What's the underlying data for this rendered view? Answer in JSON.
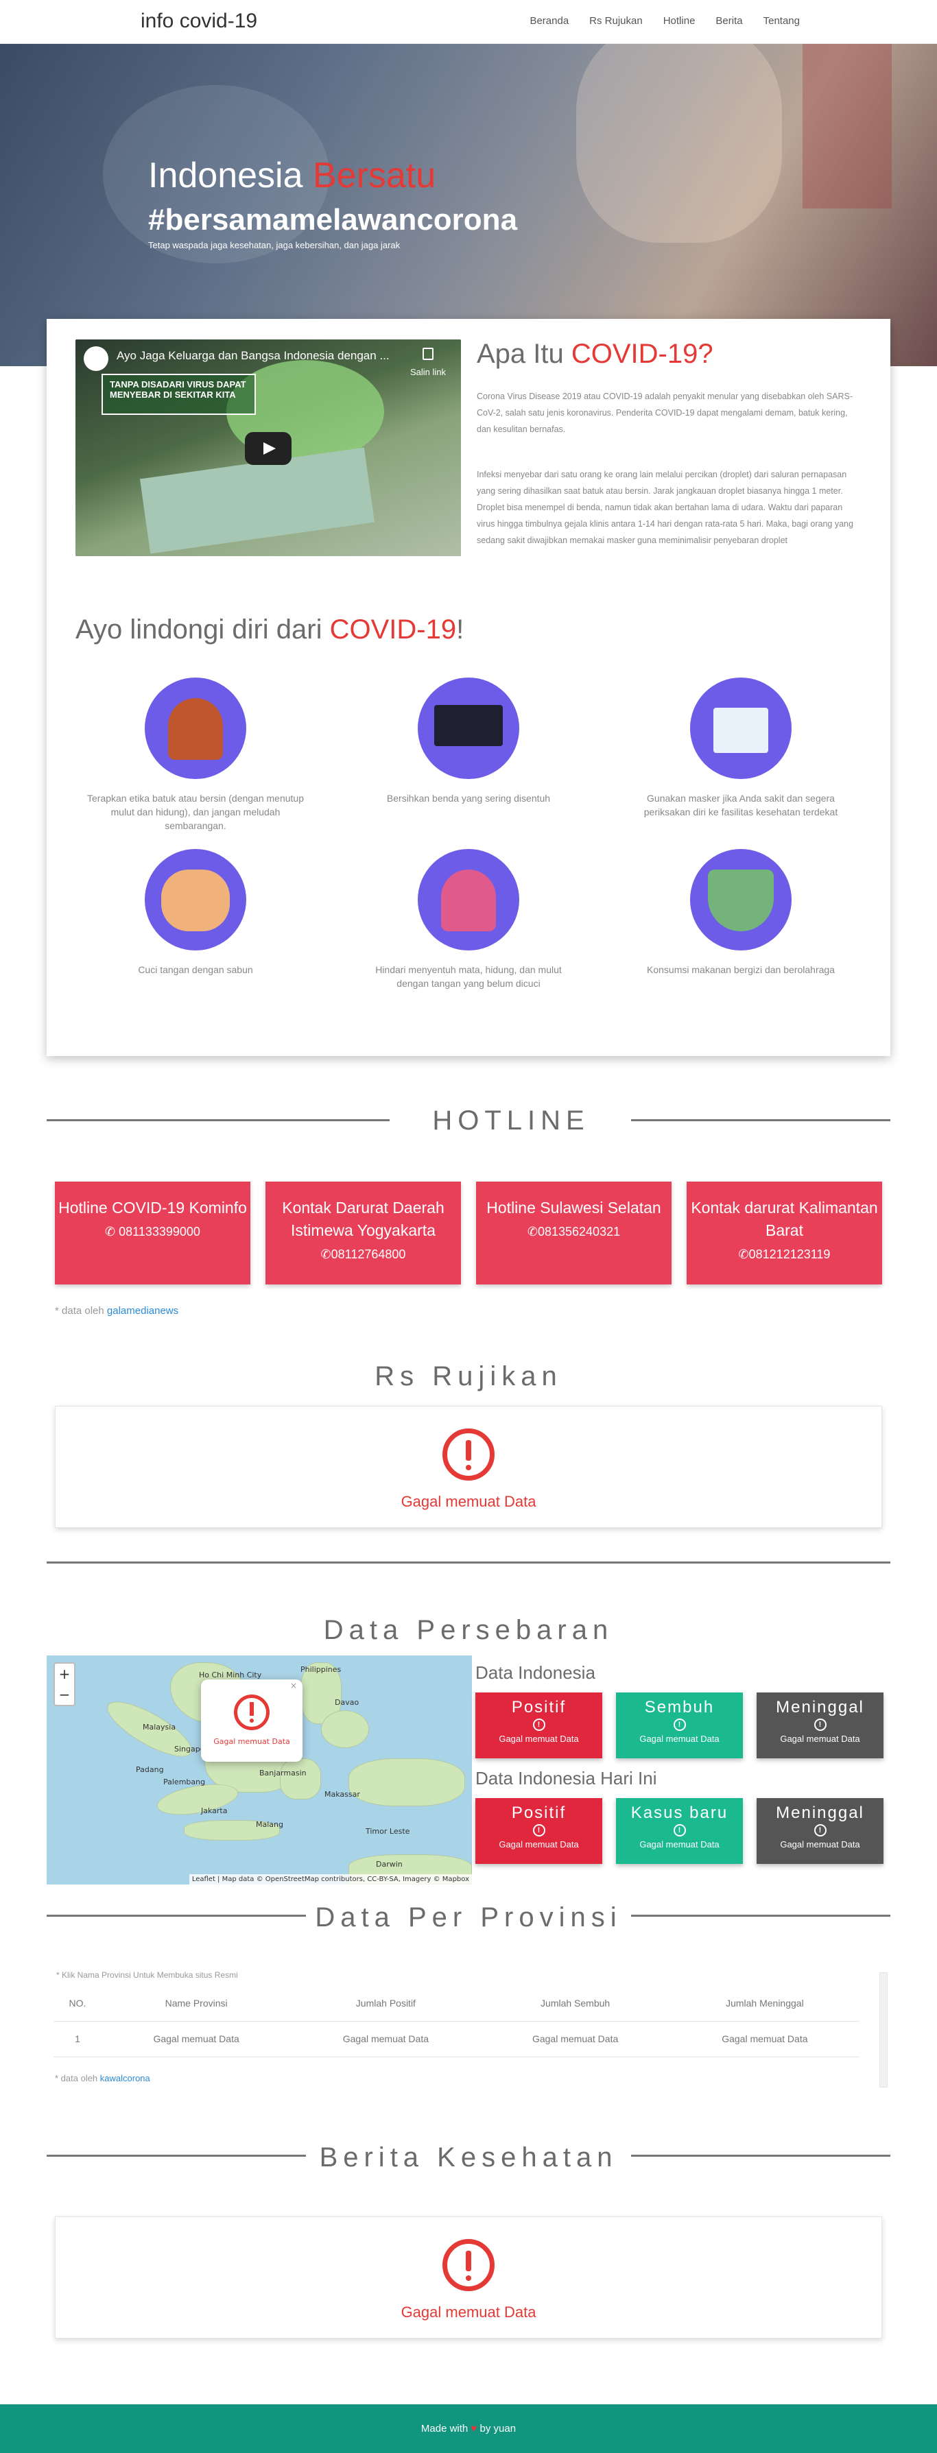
{
  "nav": {
    "brand": "info covid-19",
    "items": [
      "Beranda",
      "Rs Rujukan",
      "Hotline",
      "Berita",
      "Tentang"
    ]
  },
  "hero": {
    "title_main": "Indonesia ",
    "title_accent": "Bersatu",
    "hashtag": "#bersamamelawancorona",
    "subtitle": "Tetap waspada jaga kesehatan, jaga kebersihan, dan jaga jarak"
  },
  "video": {
    "title": "Ayo Jaga Keluarga dan Bangsa Indonesia dengan ...",
    "copy_label": "Salin link",
    "banner": "TANPA DISADARI VIRUS DAPAT MENYEBAR DI SEKITAR KITA"
  },
  "apa": {
    "title_main": "Apa Itu ",
    "title_accent": "COVID-19?",
    "p1": "Corona Virus Disease 2019 atau COVID-19 adalah penyakit menular yang disebabkan oleh SARS-CoV-2, salah satu jenis koronavirus. Penderita COVID-19 dapat mengalami demam, batuk kering, dan kesulitan bernafas.",
    "p2": "Infeksi menyebar dari satu orang ke orang lain melalui percikan (droplet) dari saluran pernapasan yang sering dihasilkan saat batuk atau bersin. Jarak jangkauan droplet biasanya hingga 1 meter. Droplet bisa menempel di benda, namun tidak akan bertahan lama di udara. Waktu dari paparan virus hingga timbulnya gejala klinis antara 1-14 hari dengan rata-rata 5 hari. Maka, bagi orang yang sedang sakit diwajibkan memakai masker guna meminimalisir penyebaran droplet"
  },
  "lindungi": {
    "title_main": "Ayo lindongi diri dari ",
    "title_accent": "COVID-19",
    "title_end": "!",
    "tips": [
      "Terapkan etika batuk atau bersin (dengan menutup mulut dan hidung), dan jangan meludah sembarangan.",
      "Bersihkan benda yang sering disentuh",
      "Gunakan masker jika Anda sakit dan segera periksakan diri ke fasilitas kesehatan terdekat",
      "Cuci tangan dengan sabun",
      "Hindari menyentuh mata, hidung, dan mulut dengan tangan yang belum dicuci",
      "Konsumsi makanan bergizi dan berolahraga"
    ]
  },
  "hotline": {
    "title": "HOTLINE",
    "items": [
      {
        "name": "Hotline COVID-19 Kominfo",
        "phone": "081133399000"
      },
      {
        "name": "Kontak Darurat Daerah Istimewa Yogyakarta",
        "phone": "08112764800"
      },
      {
        "name": "Hotline Sulawesi Selatan",
        "phone": "081356240321"
      },
      {
        "name": "Kontak darurat Kalimantan Barat",
        "phone": "081212123119"
      }
    ],
    "note_prefix": "* data oleh ",
    "note_link": "galamedianews"
  },
  "rs": {
    "title": "Rs Rujikan",
    "error": "Gagal memuat Data"
  },
  "persebaran": {
    "title": "Data Persebaran",
    "map_popup": "Gagal memuat Data",
    "map_attr": "Leaflet | Map data © OpenStreetMap contributors, CC-BY-SA, Imagery © Mapbox",
    "cities": [
      "Ho Chi Minh City",
      "Philippines",
      "Davao",
      "Malaysia",
      "Singapore",
      "Padang",
      "Palembang",
      "Banjarmasin",
      "Makassar",
      "Jakarta",
      "Malang",
      "Timor Leste",
      "Darwin"
    ],
    "indonesia_label": "Data Indonesia",
    "today_label": "Data Indonesia Hari Ini",
    "stats": [
      {
        "label": "Positif",
        "value": "Gagal memuat Data",
        "color": "#e0273e"
      },
      {
        "label": "Sembuh",
        "value": "Gagal memuat Data",
        "color": "#1ab98f"
      },
      {
        "label": "Meninggal",
        "value": "Gagal memuat Data",
        "color": "#555555"
      }
    ],
    "stats_today": [
      {
        "label": "Positif",
        "value": "Gagal memuat Data",
        "color": "#e0273e"
      },
      {
        "label": "Kasus baru",
        "value": "Gagal memuat Data",
        "color": "#1ab98f"
      },
      {
        "label": "Meninggal",
        "value": "Gagal memuat Data",
        "color": "#555555"
      }
    ]
  },
  "provinsi": {
    "title": "Data Per Provinsi",
    "note": "* Klik Nama Provinsi Untuk Membuka situs Resmi",
    "headers": [
      "NO.",
      "Name Provinsi",
      "Jumlah Positif",
      "Jumlah Sembuh",
      "Jumlah Meninggal"
    ],
    "row": [
      "1",
      "Gagal memuat Data",
      "Gagal memuat Data",
      "Gagal memuat Data",
      "Gagal memuat Data"
    ],
    "source_prefix": "* data oleh ",
    "source_link": "kawalcorona"
  },
  "berita": {
    "title": "Berita Kesehatan",
    "error": "Gagal memuat Data"
  },
  "footer": {
    "prefix": "Made with ",
    "heart": "♥",
    "suffix": " by yuan"
  }
}
